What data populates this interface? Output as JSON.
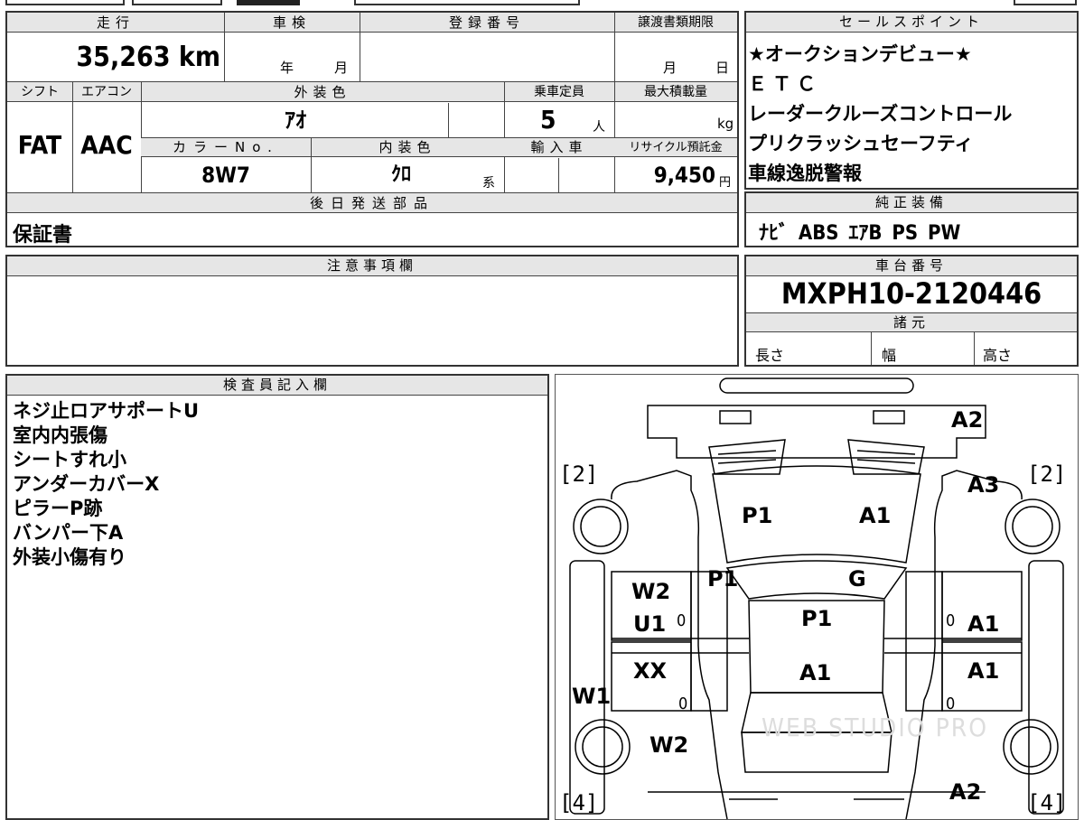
{
  "vehicle": {
    "mileage_header": "走行",
    "mileage": "35,263 km",
    "inspection_header": "車検",
    "inspection_year_unit": "年",
    "inspection_month_unit": "月",
    "registration_header": "登録番号",
    "transfer_header": "譲渡書類期限",
    "transfer_month_unit": "月",
    "transfer_day_unit": "日",
    "shift_header": "シフト",
    "shift": "FAT",
    "ac_header": "エアコン",
    "ac": "AAC",
    "exterior_color_header": "外装色",
    "exterior_color": "ｱｵ",
    "capacity_header": "乗車定員",
    "capacity": "5",
    "capacity_unit": "人",
    "max_load_header": "最大積載量",
    "max_load_unit": "kg",
    "color_no_header": "カラーNo.",
    "color_no": "8W7",
    "interior_color_header": "内装色",
    "interior_color": "ｸﾛ",
    "interior_suffix": "系",
    "import_header": "輸入車",
    "recycle_header": "リサイクル預託金",
    "recycle_fee": "9,450",
    "recycle_unit": "円",
    "later_parts_header": "後日発送部品",
    "later_parts": "保証書"
  },
  "sales_points": {
    "header": "セールスポイント",
    "items": [
      "★オークションデビュー★",
      "ＥＴＣ",
      "レーダークルーズコントロール",
      "プリクラッシュセーフティ",
      "車線逸脱警報"
    ]
  },
  "equipment": {
    "header": "純正装備",
    "items": "ﾅﾋﾞ ABS ｴｱB PS PW"
  },
  "notes": {
    "header": "注意事項欄"
  },
  "chassis": {
    "header": "車台番号",
    "number": "MXPH10-2120446"
  },
  "specs": {
    "header": "諸元",
    "length": "長さ",
    "width": "幅",
    "height": "高さ"
  },
  "inspector": {
    "header": "検査員記入欄",
    "lines": [
      "ネジ止ロアサポートU",
      "室内内張傷",
      "シートすれ小",
      "アンダーカバーX",
      "ピラーP跡",
      "バンパー下A",
      "外装小傷有り"
    ]
  },
  "diagram": {
    "marks": {
      "top_right": "A2",
      "fl_fender": "A3",
      "hood_left": "P1",
      "hood_right": "A1",
      "pillar_left": "P1",
      "windshield": "G",
      "front_door_left_1": "W2",
      "front_door_left_2": "U1",
      "roof": "P1",
      "front_door_right": "A1",
      "rear_door_left": "XX",
      "roof_rear": "A1",
      "rear_door_right": "A1",
      "rocker_left": "W1",
      "rear_quarter_left": "W2",
      "rear_bottom_right": "A2"
    },
    "zero": "0",
    "tire_fl": "2",
    "tire_fr": "2",
    "tire_rl": "4",
    "tire_rr": "4",
    "watermark": "WEB STUDIO PRO"
  }
}
